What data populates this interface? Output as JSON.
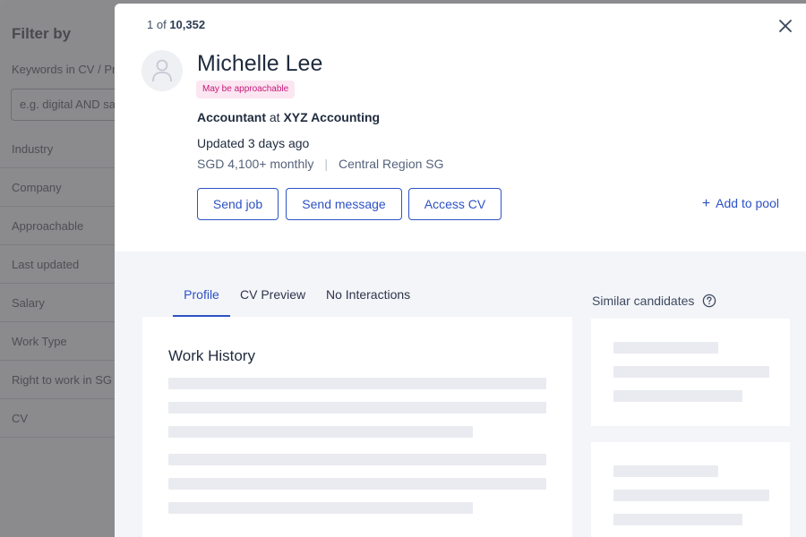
{
  "sidebar": {
    "title": "Filter by",
    "keywords_label": "Keywords in CV / Profile",
    "keywords_placeholder": "e.g. digital AND sales",
    "filters": [
      "Industry",
      "Company",
      "Approachable",
      "Last updated",
      "Salary",
      "Work Type",
      "Right to work in SG",
      "CV"
    ]
  },
  "panel": {
    "counter_current": "1",
    "counter_of": "of",
    "counter_total": "10,352",
    "candidate": {
      "name": "Michelle Lee",
      "badge": "May be approachable",
      "role": "Accountant",
      "at": "at",
      "company": "XYZ Accounting",
      "updated": "Updated 3 days ago",
      "salary": "SGD 4,100+ monthly",
      "location": "Central Region SG"
    },
    "actions": {
      "send_job": "Send job",
      "send_message": "Send message",
      "access_cv": "Access CV",
      "add_to_pool": "Add to pool"
    },
    "tabs": [
      {
        "label": "Profile",
        "active": true
      },
      {
        "label": "CV Preview",
        "active": false
      },
      {
        "label": "No Interactions",
        "active": false
      }
    ],
    "work_history_heading": "Work History",
    "similar_title": "Similar candidates"
  },
  "colors": {
    "accent": "#2d52c4",
    "badge_bg": "#fbe6f1",
    "badge_text": "#c8187a",
    "overlay": "#8b8b8e"
  },
  "icons": {
    "close": "close-icon",
    "avatar": "user-icon",
    "help": "question-circle-icon",
    "plus": "plus-icon"
  }
}
